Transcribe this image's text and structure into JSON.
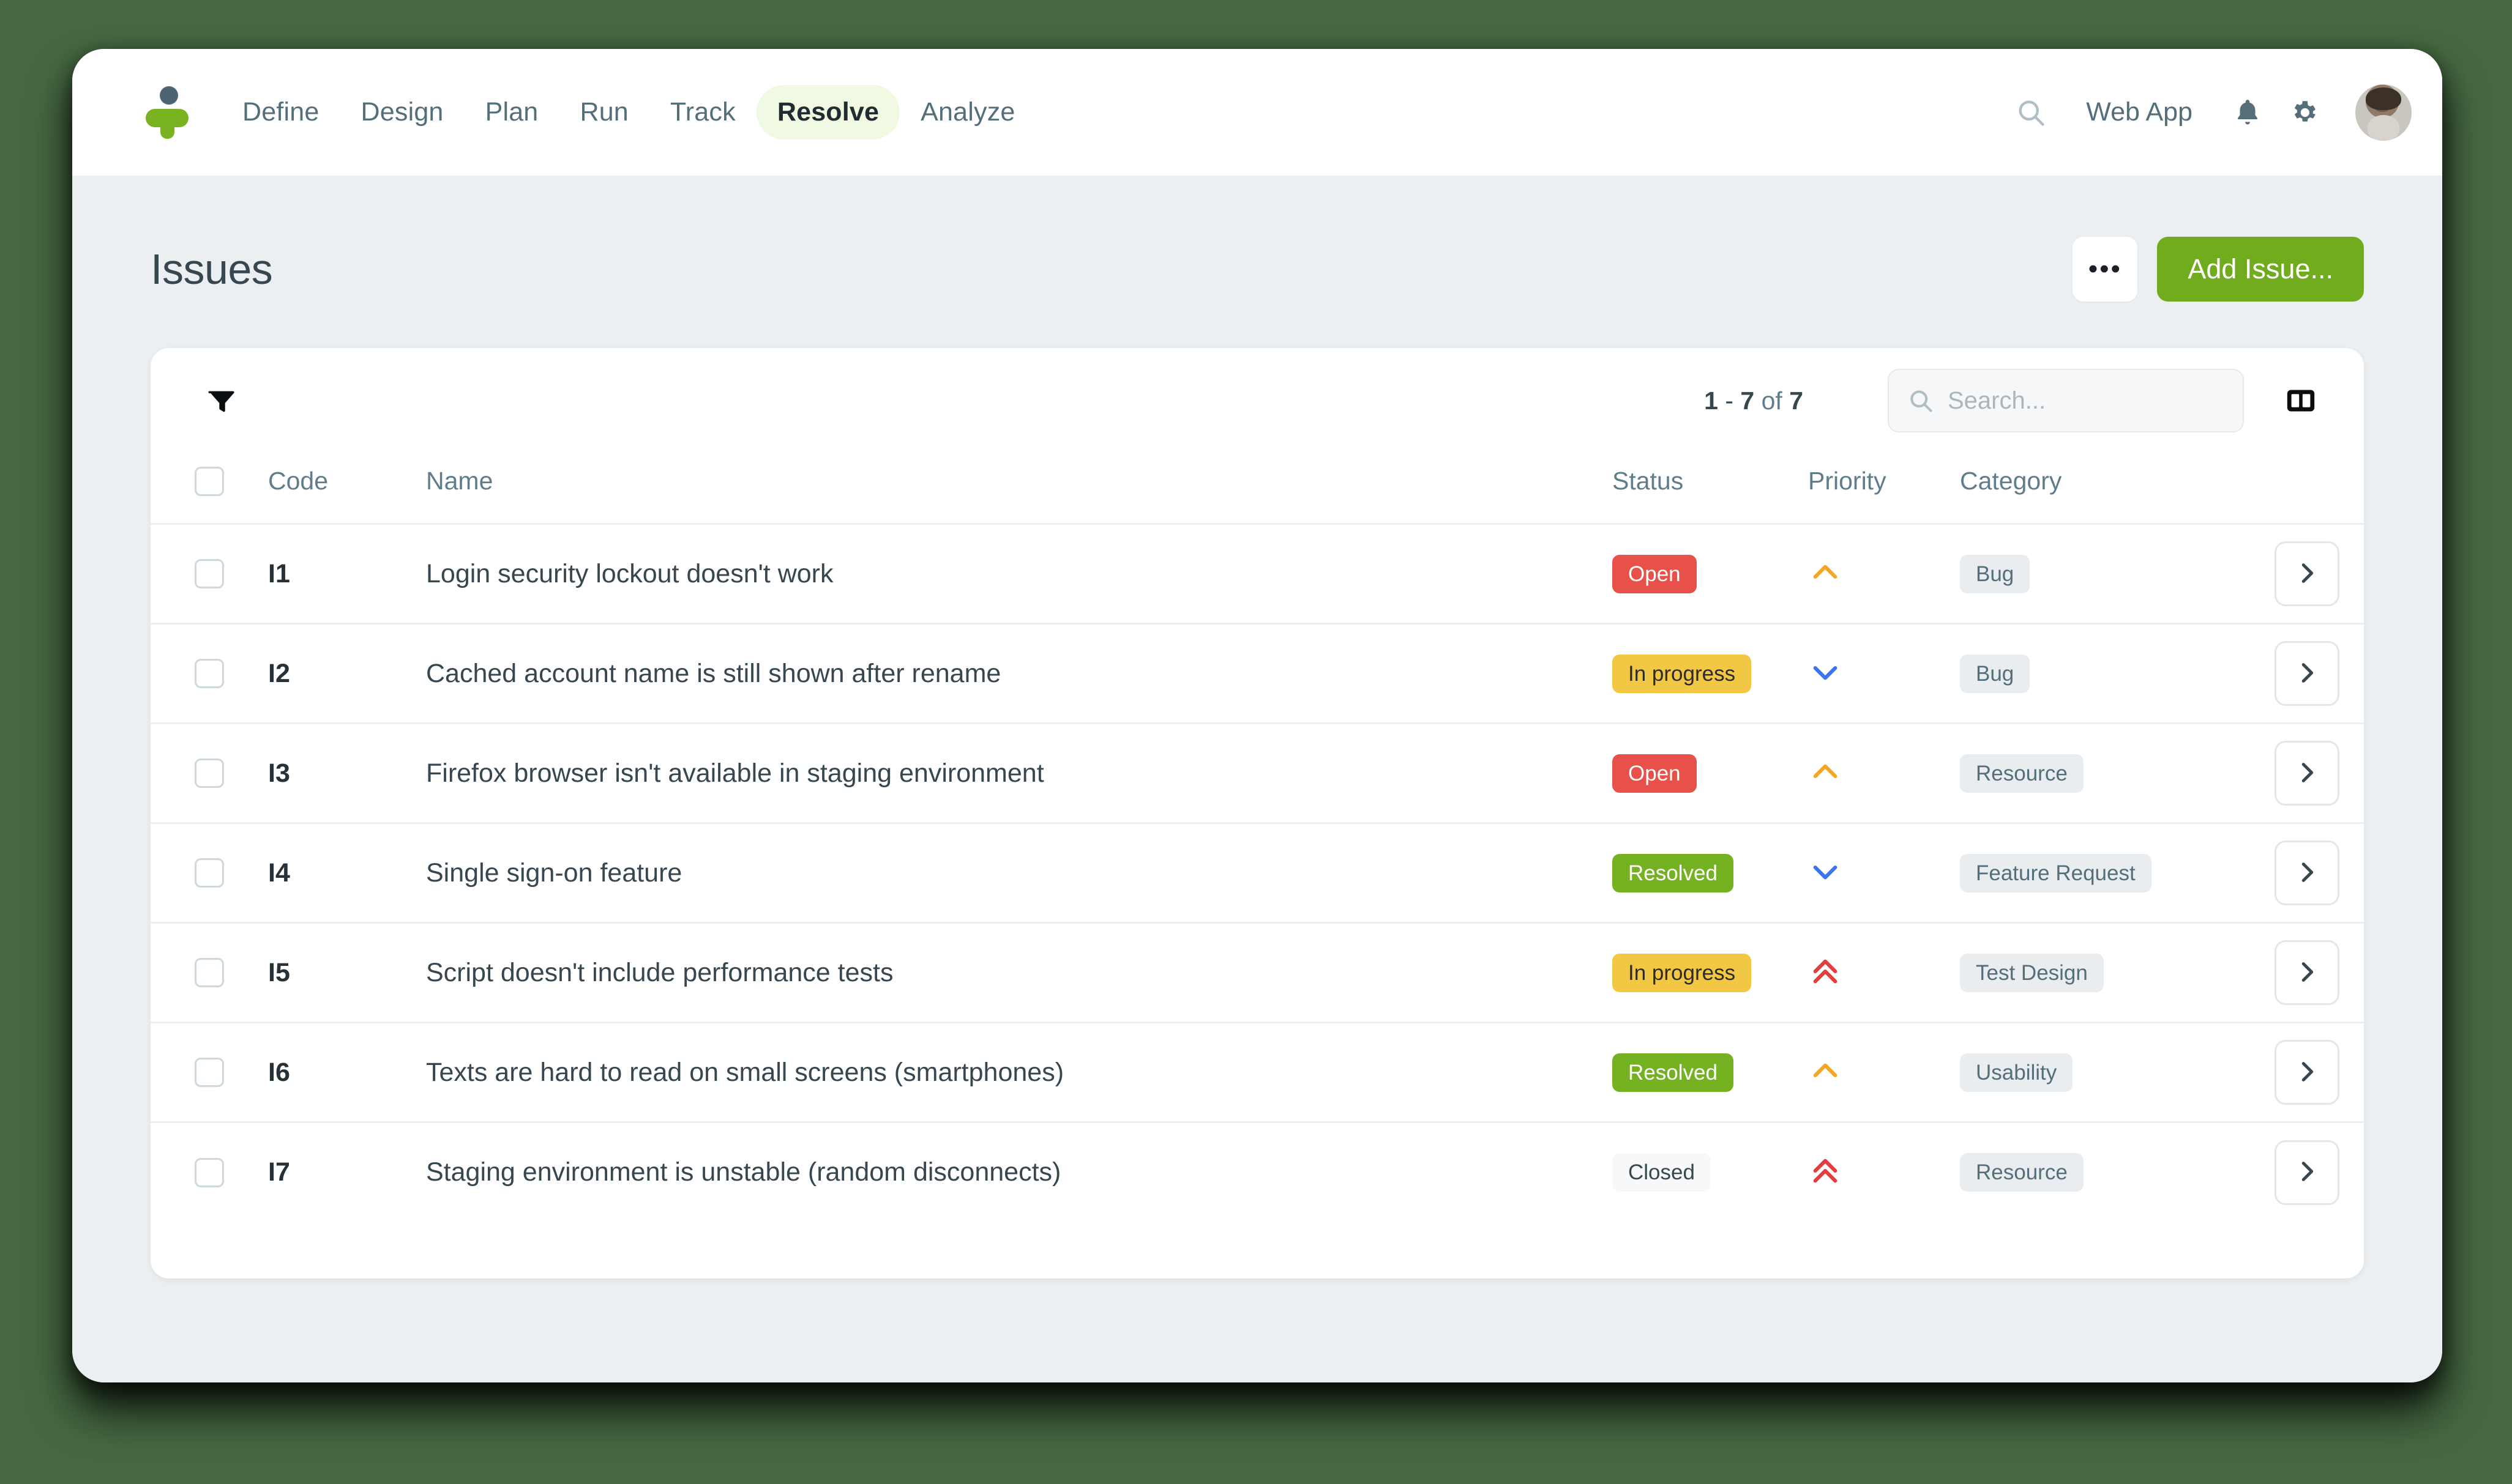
{
  "colors": {
    "brand_green": "#79b322",
    "accent_button": "#71ab1e",
    "status_open": "#e8504a",
    "status_in_progress": "#f2c744",
    "status_resolved": "#74b221",
    "status_closed": "#f6f8f9",
    "priority_medium": "#f5a623",
    "priority_low": "#3b74f0",
    "priority_high": "#e33d3d",
    "desktop_background": "#456841",
    "page_background": "#eceff1"
  },
  "topbar": {
    "logo_name": "app-logo",
    "nav": [
      {
        "label": "Define",
        "active": false
      },
      {
        "label": "Design",
        "active": false
      },
      {
        "label": "Plan",
        "active": false
      },
      {
        "label": "Run",
        "active": false
      },
      {
        "label": "Track",
        "active": false
      },
      {
        "label": "Resolve",
        "active": true
      },
      {
        "label": "Analyze",
        "active": false
      }
    ],
    "search_icon": "search-icon",
    "project_label": "Web App",
    "notifications_icon": "bell-icon",
    "settings_icon": "gear-icon",
    "avatar_label": "user-avatar"
  },
  "page": {
    "title": "Issues",
    "more_button_label": "•••",
    "add_button_label": "Add Issue..."
  },
  "toolbar": {
    "filter_icon": "filter-icon",
    "pagination": {
      "range_start": "1",
      "separator": " - ",
      "range_end": "7",
      "of_word": " of ",
      "total": "7"
    },
    "search": {
      "placeholder": "Search...",
      "value": ""
    },
    "columns_icon": "columns-icon"
  },
  "table": {
    "columns": [
      "",
      "Code",
      "Name",
      "Status",
      "Priority",
      "Category",
      ""
    ],
    "headers": {
      "code": "Code",
      "name": "Name",
      "status": "Status",
      "priority": "Priority",
      "category": "Category"
    },
    "rows": [
      {
        "code": "I1",
        "name": "Login security lockout doesn't work",
        "status": "Open",
        "status_kind": "open",
        "priority": "medium",
        "priority_icon": "chevron-up-icon",
        "category": "Bug"
      },
      {
        "code": "I2",
        "name": "Cached account name is still shown after rename",
        "status": "In progress",
        "status_kind": "inprogress",
        "priority": "low",
        "priority_icon": "chevron-down-icon",
        "category": "Bug"
      },
      {
        "code": "I3",
        "name": "Firefox browser isn't available in staging environment",
        "status": "Open",
        "status_kind": "open",
        "priority": "medium",
        "priority_icon": "chevron-up-icon",
        "category": "Resource"
      },
      {
        "code": "I4",
        "name": "Single sign-on feature",
        "status": "Resolved",
        "status_kind": "resolved",
        "priority": "low",
        "priority_icon": "chevron-down-icon",
        "category": "Feature Request"
      },
      {
        "code": "I5",
        "name": "Script doesn't include performance tests",
        "status": "In progress",
        "status_kind": "inprogress",
        "priority": "high",
        "priority_icon": "double-chevron-up-icon",
        "category": "Test Design"
      },
      {
        "code": "I6",
        "name": "Texts are hard to read on small screens (smartphones)",
        "status": "Resolved",
        "status_kind": "resolved",
        "priority": "medium",
        "priority_icon": "chevron-up-icon",
        "category": "Usability"
      },
      {
        "code": "I7",
        "name": "Staging environment is unstable (random disconnects)",
        "status": "Closed",
        "status_kind": "closed",
        "priority": "high",
        "priority_icon": "double-chevron-up-icon",
        "category": "Resource"
      }
    ]
  }
}
